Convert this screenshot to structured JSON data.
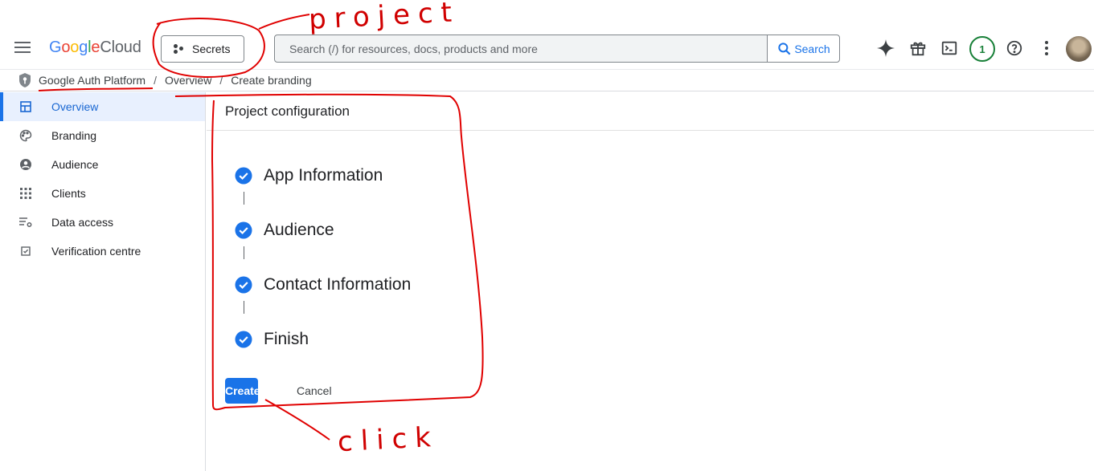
{
  "header": {
    "logo": {
      "brand": "Google",
      "product": "Cloud"
    },
    "project_selector": "Secrets",
    "search": {
      "placeholder": "Search (/) for resources, docs, products and more",
      "button_label": "Search"
    },
    "notification_count": "1"
  },
  "breadcrumb": {
    "items": [
      "Google Auth Platform",
      "Overview",
      "Create branding"
    ],
    "separator": "/"
  },
  "sidebar": {
    "items": [
      {
        "label": "Overview",
        "icon": "dashboard-icon",
        "active": true
      },
      {
        "label": "Branding",
        "icon": "palette-icon"
      },
      {
        "label": "Audience",
        "icon": "person-circle-icon"
      },
      {
        "label": "Clients",
        "icon": "grid-icon"
      },
      {
        "label": "Data access",
        "icon": "list-settings-icon"
      },
      {
        "label": "Verification centre",
        "icon": "checkbox-icon"
      }
    ]
  },
  "main": {
    "title": "Project configuration",
    "steps": [
      {
        "label": "App Information",
        "status": "complete"
      },
      {
        "label": "Audience",
        "status": "complete"
      },
      {
        "label": "Contact Information",
        "status": "complete"
      },
      {
        "label": "Finish",
        "status": "complete"
      }
    ],
    "create_label": "Create",
    "cancel_label": "Cancel"
  },
  "annotations": {
    "project_note": "project",
    "click_note": "click"
  },
  "colors": {
    "accent": "#1a73e8",
    "active_bg": "#e8f0fe",
    "annotation": "#d00000",
    "badge": "#188038"
  }
}
